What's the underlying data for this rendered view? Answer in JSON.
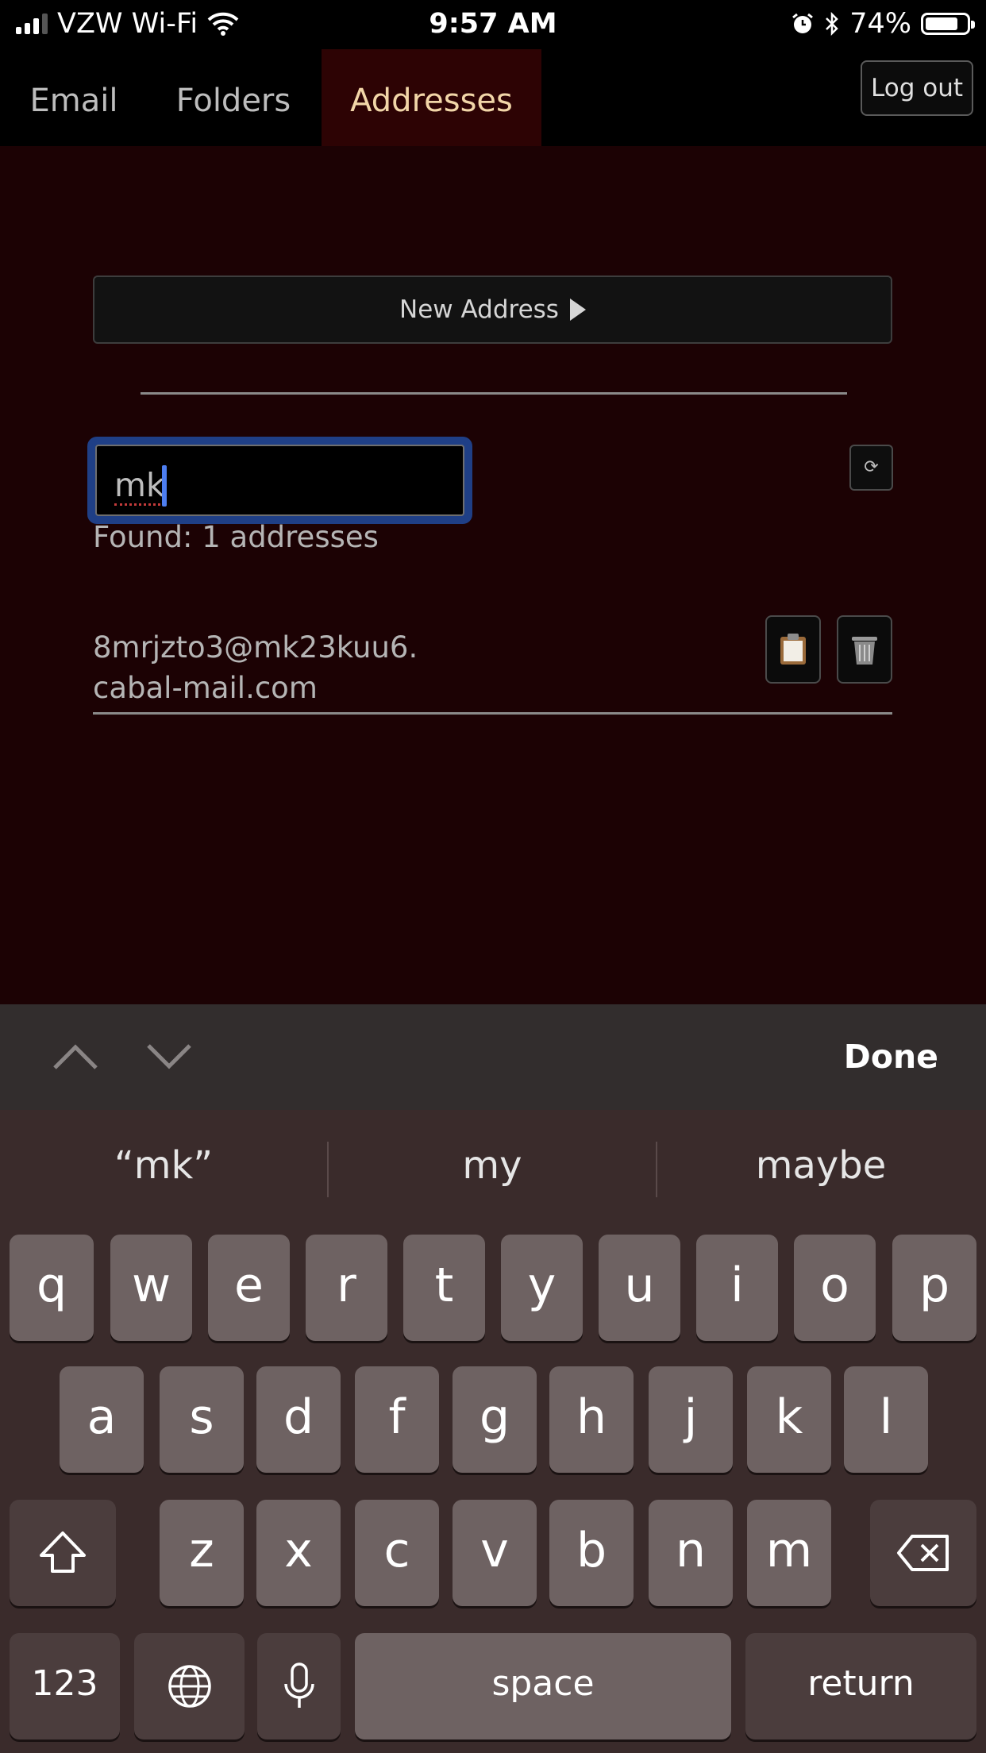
{
  "status": {
    "carrier": "VZW Wi-Fi",
    "time": "9:57 AM",
    "battery": "74%"
  },
  "tabs": [
    {
      "label": "Email"
    },
    {
      "label": "Folders"
    },
    {
      "label": "Addresses"
    }
  ],
  "logout_label": "Log out",
  "new_address_label": "New Address",
  "search": {
    "value": "mk"
  },
  "refresh_symbol": "⟳",
  "found_text": "Found: 1 addresses",
  "address": {
    "line1": "8mrjzto3@mk23kuu6.",
    "line2": "cabal-mail.com"
  },
  "accessory": {
    "done_label": "Done"
  },
  "suggestions": [
    "“mk”",
    "my",
    "maybe"
  ],
  "keys": {
    "row1": [
      "q",
      "w",
      "e",
      "r",
      "t",
      "y",
      "u",
      "i",
      "o",
      "p"
    ],
    "row2": [
      "a",
      "s",
      "d",
      "f",
      "g",
      "h",
      "j",
      "k",
      "l"
    ],
    "row3": [
      "z",
      "x",
      "c",
      "v",
      "b",
      "n",
      "m"
    ],
    "numbers_label": "123",
    "space_label": "space",
    "return_label": "return"
  },
  "colors": {
    "background": "#1c0204",
    "active_tab": "#2d0304",
    "active_tab_text": "#f2d6a8",
    "search_focus": "#1f3f86"
  },
  "icons": [
    "wifi-icon",
    "alarm-icon",
    "bluetooth-icon",
    "battery-icon",
    "play-triangle-icon",
    "refresh-icon",
    "clipboard-icon",
    "trash-icon",
    "chevron-up-icon",
    "chevron-down-icon",
    "shift-icon",
    "backspace-icon",
    "globe-icon",
    "microphone-icon"
  ]
}
